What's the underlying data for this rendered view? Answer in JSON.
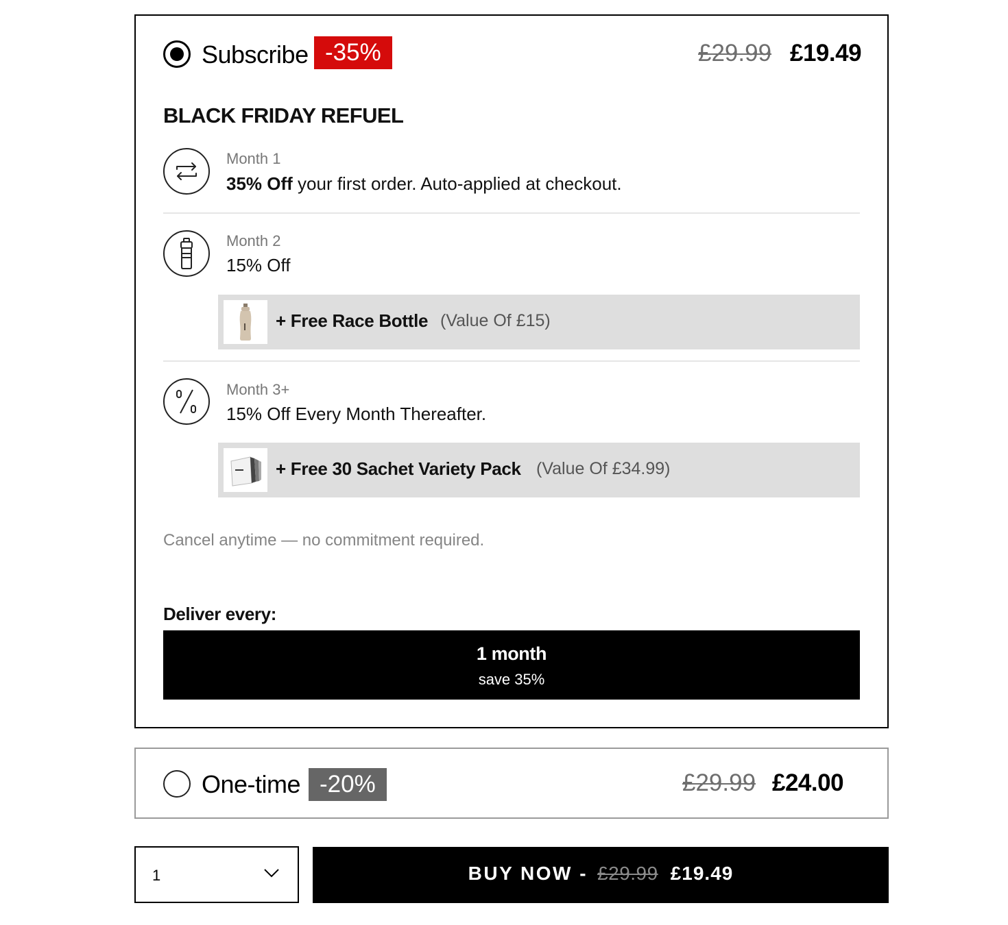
{
  "subscribe": {
    "title": "Subscribe",
    "badge": "-35%",
    "price_old": "£29.99",
    "price_new": "£19.49",
    "offer_title": "BLACK FRIDAY REFUEL",
    "steps": [
      {
        "icon": "repeat-icon",
        "label": "Month 1",
        "desc_bold": "35% Off",
        "desc_rest": " your first order. Auto-applied at checkout."
      },
      {
        "icon": "bottle-icon",
        "label": "Month 2",
        "desc": "15% Off",
        "gift": {
          "thumb": "race-bottle-thumbnail",
          "name": "+ Free Race Bottle",
          "value": "(Value Of £15)"
        }
      },
      {
        "icon": "percent-icon",
        "label": "Month 3+",
        "desc": "15% Off Every Month Thereafter.",
        "gift": {
          "thumb": "sachet-pack-thumbnail",
          "name": "+ Free 30 Sachet Variety Pack",
          "value": "(Value Of £34.99)"
        }
      }
    ],
    "note": "Cancel anytime — no commitment required.",
    "deliver_label": "Deliver every:",
    "deliver_option": {
      "main": "1 month",
      "sub": "save 35%"
    },
    "selected": true
  },
  "one_time": {
    "title": "One-time",
    "badge": "-20%",
    "price_old": "£29.99",
    "price_new": "£24.00",
    "selected": false
  },
  "quantity": {
    "value": "1"
  },
  "buy_button": {
    "label": "BUY NOW -",
    "price_old": "£29.99",
    "price_new": "£19.49"
  },
  "colors": {
    "badge_red": "#d50b0b",
    "badge_grey": "#666666",
    "button_black": "#000000",
    "gift_bg": "#dedede"
  }
}
